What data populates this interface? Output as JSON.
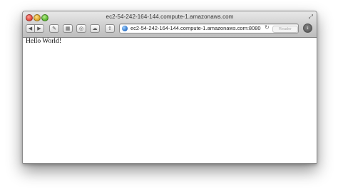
{
  "window": {
    "title": "ec2-54-242-164-144.compute-1.amazonaws.com"
  },
  "toolbar": {
    "back_icon": "back-arrow-icon",
    "forward_icon": "forward-arrow-icon",
    "address": "ec2-54-242-164-144.compute-1.amazonaws.com:8080",
    "reader_label": "Reader"
  },
  "page": {
    "body_text": "Hello World!"
  },
  "colors": {
    "close": "#e2463b",
    "minimize": "#dba327",
    "zoom": "#5ab52f"
  }
}
